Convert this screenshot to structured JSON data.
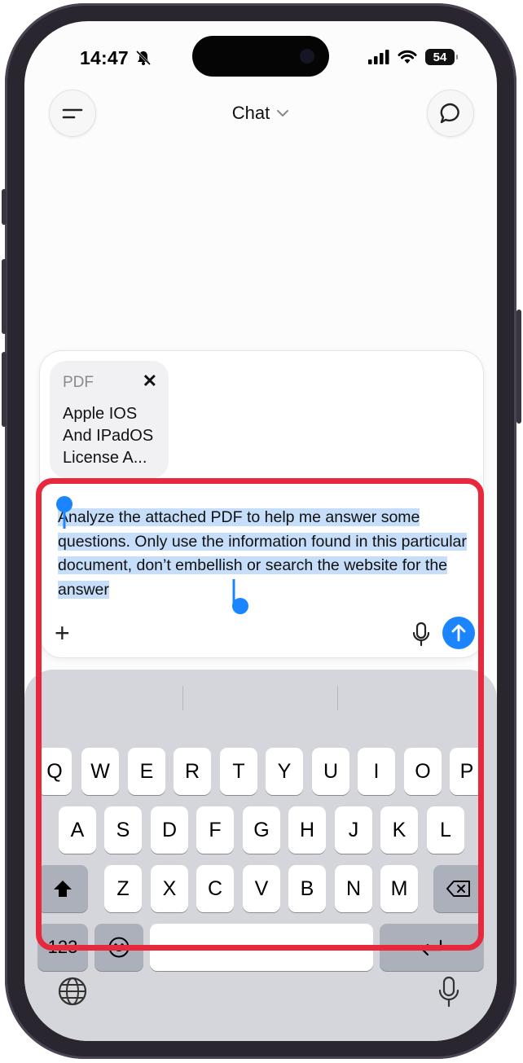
{
  "status_bar": {
    "time": "14:47",
    "battery": "54"
  },
  "header": {
    "title": "Chat"
  },
  "attachment": {
    "type": "PDF",
    "name": "Apple IOS And IPadOS License A..."
  },
  "composer": {
    "message": "Analyze the attached PDF to help me answer some questions. Only use the information found in this particular document, don’t embellish or search the website for the answer"
  },
  "keyboard": {
    "row1": [
      "Q",
      "W",
      "E",
      "R",
      "T",
      "Y",
      "U",
      "I",
      "O",
      "P"
    ],
    "row2": [
      "A",
      "S",
      "D",
      "F",
      "G",
      "H",
      "J",
      "K",
      "L"
    ],
    "row3": [
      "Z",
      "X",
      "C",
      "V",
      "B",
      "N",
      "M"
    ],
    "numbers_key": "123"
  },
  "colors": {
    "accent": "#1a85ff",
    "selection": "#c6def9",
    "highlight_border": "#e8283c"
  }
}
